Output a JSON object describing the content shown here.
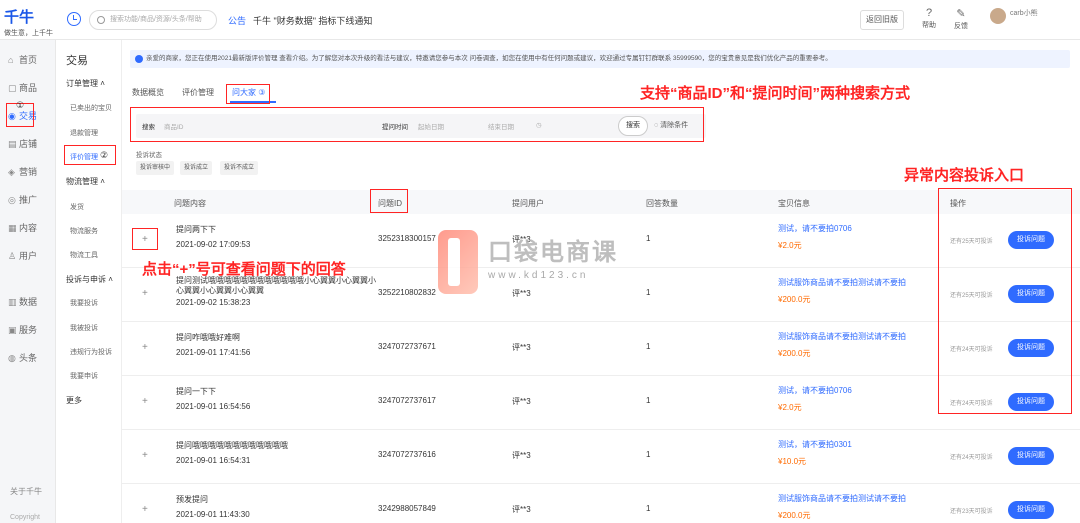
{
  "topbar": {
    "brand": "千牛",
    "slogan": "做生意，上千牛",
    "search_placeholder": "搜索功能/商品/资源/头条/帮助",
    "notice_label": "公告",
    "notice_text": "千牛 \"财务数据\" 指标下线通知",
    "old_version": "返回旧版",
    "help": "帮助",
    "feedback": "反馈",
    "user_name": "carb小熊"
  },
  "nav": {
    "items": [
      {
        "label": "首页",
        "icon": "home-icon"
      },
      {
        "label": "商品",
        "icon": "box-icon"
      },
      {
        "label": "交易",
        "icon": "trade-icon"
      },
      {
        "label": "店铺",
        "icon": "store-icon"
      },
      {
        "label": "营销",
        "icon": "marketing-icon"
      },
      {
        "label": "推广",
        "icon": "promote-icon"
      },
      {
        "label": "内容",
        "icon": "content-icon"
      },
      {
        "label": "用户",
        "icon": "user-icon"
      },
      {
        "label": "数据",
        "icon": "data-icon"
      },
      {
        "label": "服务",
        "icon": "service-icon"
      },
      {
        "label": "头条",
        "icon": "news-icon"
      }
    ],
    "about": "关于千牛",
    "copyright": "Copyright"
  },
  "subnav": {
    "title": "交易",
    "groups": [
      {
        "label": "订单管理",
        "items": [
          "已卖出的宝贝",
          "退款管理",
          "评价管理"
        ]
      },
      {
        "label": "物流管理",
        "items": [
          "发货",
          "物流服务",
          "物流工具"
        ]
      },
      {
        "label": "投诉与申诉",
        "items": [
          "我要投诉",
          "我被投诉",
          "违规行为投诉",
          "我要申诉"
        ]
      },
      {
        "label": "更多",
        "items": []
      }
    ]
  },
  "banner": "亲爱的商家，您正在使用2021最新版评价管理 查看介绍。为了解您对本次升级的看法与建议，特邀请您参与本次 问卷调查，如您在使用中有任何问题或建议，欢迎通过专属钉钉群联系 35999590，您的宝贵意见是我们优化产品的重要参考。",
  "tabs": [
    "数据概览",
    "评价管理",
    "问大家"
  ],
  "filter": {
    "search_label": "搜索",
    "search_placeholder": "商品ID",
    "time_label": "提问时间",
    "start_placeholder": "起始日期",
    "end_placeholder": "结束日期",
    "search_button": "搜索",
    "clear_button": "清除条件",
    "status_label": "投诉状态",
    "chips": [
      "投诉审核中",
      "投诉成立",
      "投诉不成立"
    ]
  },
  "table": {
    "headers": [
      "问题内容",
      "问题ID",
      "提问用户",
      "回答数量",
      "宝贝信息",
      "操作"
    ],
    "rows": [
      {
        "expand": "+",
        "question": "提问两下下",
        "time": "2021-09-02 17:09:53",
        "qid": "3252318300157",
        "user": "评**3",
        "count": "1",
        "product": "测试，请不要拍0706",
        "price": "¥2.0元",
        "days": "还有25天可投诉",
        "action": "投诉问题"
      },
      {
        "expand": "+",
        "question": "提问测试哦哦哦哦哦哦哦哦哦哦哦哦小心翼翼小心翼翼小心翼翼小心翼翼小心翼翼",
        "time": "2021-09-02 15:38:23",
        "qid": "3252210802832",
        "user": "评**3",
        "count": "1",
        "product": "测试服饰商品请不要拍测试请不要拍",
        "price": "¥200.0元",
        "days": "还有25天可投诉",
        "action": "投诉问题"
      },
      {
        "expand": "+",
        "question": "提问咋哦哦好难啊",
        "time": "2021-09-01 17:41:56",
        "qid": "3247072737671",
        "user": "评**3",
        "count": "1",
        "product": "测试服饰商品请不要拍测试请不要拍",
        "price": "¥200.0元",
        "days": "还有24天可投诉",
        "action": "投诉问题"
      },
      {
        "expand": "+",
        "question": "提问一下下",
        "time": "2021-09-01 16:54:56",
        "qid": "3247072737617",
        "user": "评**3",
        "count": "1",
        "product": "测试，请不要拍0706",
        "price": "¥2.0元",
        "days": "还有24天可投诉",
        "action": "投诉问题"
      },
      {
        "expand": "+",
        "question": "提问哦哦哦哦哦哦哦哦哦哦哦哦",
        "time": "2021-09-01 16:54:31",
        "qid": "3247072737616",
        "user": "评**3",
        "count": "1",
        "product": "测试，请不要拍0301",
        "price": "¥10.0元",
        "days": "还有24天可投诉",
        "action": "投诉问题"
      },
      {
        "expand": "+",
        "question": "预发提问",
        "time": "2021-09-01 11:43:30",
        "qid": "3242988057849",
        "user": "评**3",
        "count": "1",
        "product": "测试服饰商品请不要拍测试请不要拍",
        "price": "¥200.0元",
        "days": "还有23天可投诉",
        "action": "投诉问题"
      }
    ]
  },
  "annotations": {
    "search_methods": "支持“商品ID”和“提问时间”两种搜索方式",
    "complain_entry": "异常内容投诉入口",
    "expand_hint": "点击“+”号可查看问题下的回答",
    "step1": "①",
    "step2": "②",
    "step3": "③"
  },
  "watermark": {
    "title": "口袋电商课",
    "url": "www.kd123.cn"
  },
  "colors": {
    "accent": "#2f6bff",
    "price": "#ff6a00",
    "annotation": "#ff2424"
  }
}
